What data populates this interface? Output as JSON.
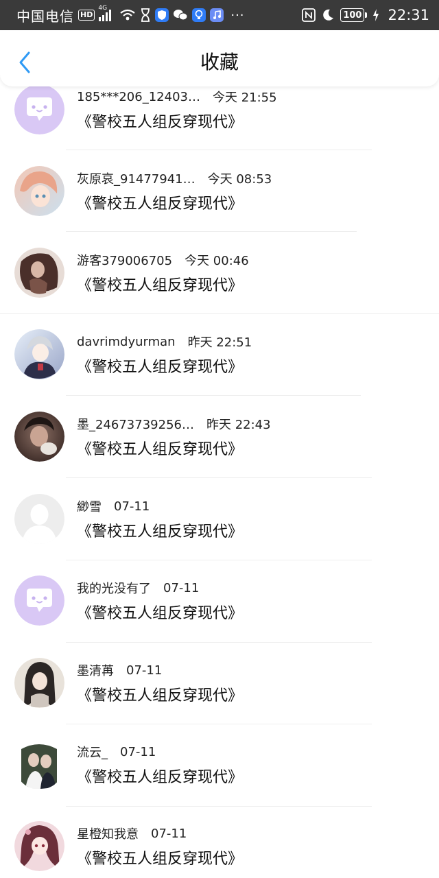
{
  "status_bar": {
    "carrier": "中国电信",
    "hd": "HD",
    "network": "4G",
    "battery": "100",
    "time": "22:31"
  },
  "header": {
    "title": "收藏"
  },
  "colors": {
    "accent": "#2f9af5",
    "placeholder_avatar": "#d9c8f5"
  },
  "items": [
    {
      "name": "185***206_12403…",
      "time": "今天 21:55",
      "title": "《警校五人组反穿现代》",
      "avatar": "placeholder-bubble-avatar"
    },
    {
      "name": "灰原哀_91477941…",
      "time": "今天 08:53",
      "title": "《警校五人组反穿现代》",
      "avatar": "anime-girl-avatar"
    },
    {
      "name": "游客379006705",
      "time": "今天 00:46",
      "title": "《警校五人组反穿现代》",
      "avatar": "photo-avatar"
    },
    {
      "name": "davrimdyurman",
      "time": "昨天 22:51",
      "title": "《警校五人组反穿现代》",
      "avatar": "anime-boy-avatar"
    },
    {
      "name": "墨_24673739256…",
      "time": "昨天 22:43",
      "title": "《警校五人组反穿现代》",
      "avatar": "photo-avatar"
    },
    {
      "name": "緲雪",
      "time": "07-11",
      "title": "《警校五人组反穿现代》",
      "avatar": "default-user-avatar"
    },
    {
      "name": "我的光没有了",
      "time": "07-11",
      "title": "《警校五人组反穿现代》",
      "avatar": "placeholder-bubble-avatar"
    },
    {
      "name": "墨清苒",
      "time": "07-11",
      "title": "《警校五人组反穿现代》",
      "avatar": "anime-girl-avatar"
    },
    {
      "name": "流云_",
      "time": "07-11",
      "title": "《警校五人组反穿现代》",
      "avatar": "photo-avatar"
    },
    {
      "name": "星橙知我意",
      "time": "07-11",
      "title": "《警校五人组反穿现代》",
      "avatar": "anime-girl-avatar"
    }
  ]
}
